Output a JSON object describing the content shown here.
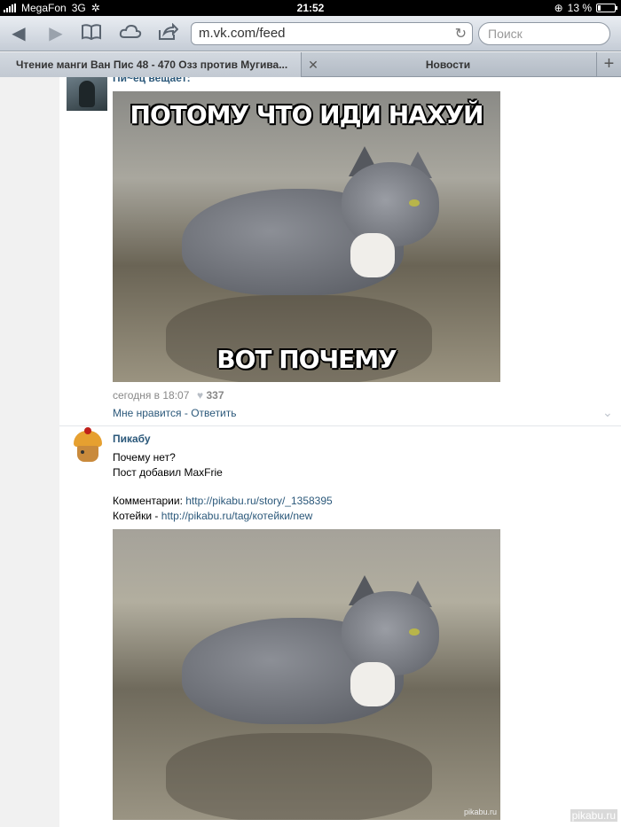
{
  "status_bar": {
    "carrier": "MegaFon",
    "network": "3G",
    "time": "21:52",
    "battery": "13 %"
  },
  "toolbar": {
    "url": "m.vk.com/feed",
    "search_placeholder": "Поиск"
  },
  "tabs": [
    {
      "label": "Чтение манги Ван Пис 48 - 470 Озз против Мугива..."
    },
    {
      "label": "Новости"
    }
  ],
  "post1": {
    "author": "Пи~ец вещает:",
    "meme_top": "ПОТОМУ ЧТО ИДИ НАХУЙ",
    "meme_bottom": "ВОТ ПОЧЕМУ",
    "time": "сегодня в 18:07",
    "likes": "337",
    "like_action": "Мне нравится",
    "separator": " - ",
    "reply_action": "Ответить"
  },
  "post2": {
    "author": "Пикабу",
    "line1": "Почему нет?",
    "line2": "Пост добавил MaxFrie",
    "comments_label": "Комментарии: ",
    "comments_link": "http://pikabu.ru/story/_1358395",
    "tag_label": "Котейки - ",
    "tag_link": "http://pikabu.ru/tag/котейки/new",
    "photo_watermark": "pikabu.ru"
  },
  "corner_watermark": "pikabu.ru",
  "icons": [
    "back-icon",
    "forward-icon",
    "bookmarks-icon",
    "cloud-icon",
    "share-icon",
    "reload-icon",
    "close-icon",
    "plus-icon",
    "heart-icon",
    "chevron-down-icon"
  ]
}
